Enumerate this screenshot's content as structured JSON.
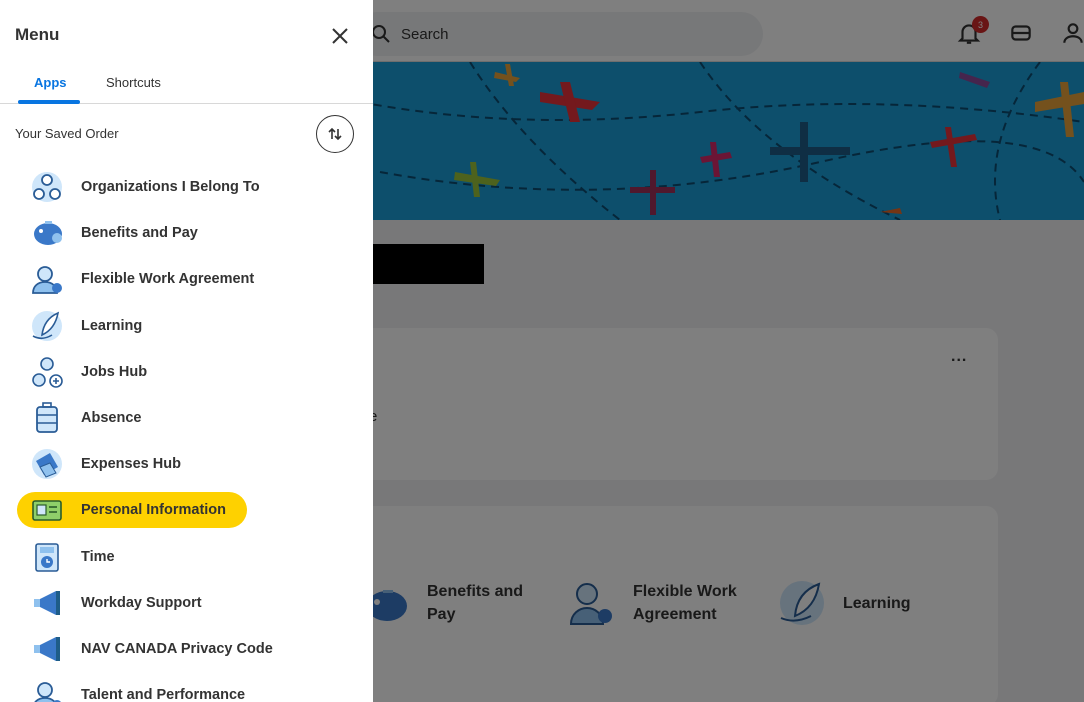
{
  "menu": {
    "title": "Menu",
    "tabs": {
      "apps": "Apps",
      "shortcuts": "Shortcuts"
    },
    "saved_order_label": "Your Saved Order",
    "items": [
      {
        "label": "Organizations I Belong To",
        "icon": "organizations-icon"
      },
      {
        "label": "Benefits and Pay",
        "icon": "piggy-bank-icon"
      },
      {
        "label": "Flexible Work Agreement",
        "icon": "person-gear-icon"
      },
      {
        "label": "Learning",
        "icon": "learning-leaf-icon"
      },
      {
        "label": "Jobs Hub",
        "icon": "jobs-hub-icon"
      },
      {
        "label": "Absence",
        "icon": "suitcase-icon"
      },
      {
        "label": "Expenses Hub",
        "icon": "expenses-icon"
      },
      {
        "label": "Personal Information",
        "icon": "id-card-icon",
        "active": true
      },
      {
        "label": "Time",
        "icon": "clock-calendar-icon"
      },
      {
        "label": "Workday Support",
        "icon": "megaphone-icon"
      },
      {
        "label": "NAV CANADA Privacy Code",
        "icon": "megaphone-icon"
      },
      {
        "label": "Talent and Performance",
        "icon": "person-star-icon"
      }
    ]
  },
  "header": {
    "search_placeholder": "Search",
    "notification_count": "3"
  },
  "main": {
    "card_menu": "...",
    "card_partial_text": "e",
    "tiles": [
      {
        "label_line1": "Benefits and",
        "label_line2": "Pay"
      },
      {
        "label_line1": "Flexible Work",
        "label_line2": "Agreement"
      },
      {
        "label_line1": "Learning",
        "label_line2": ""
      }
    ]
  },
  "colors": {
    "accent": "#0875e1",
    "highlight": "#fed100",
    "banner": "#1a9ed8",
    "badge": "#d22a2a"
  }
}
